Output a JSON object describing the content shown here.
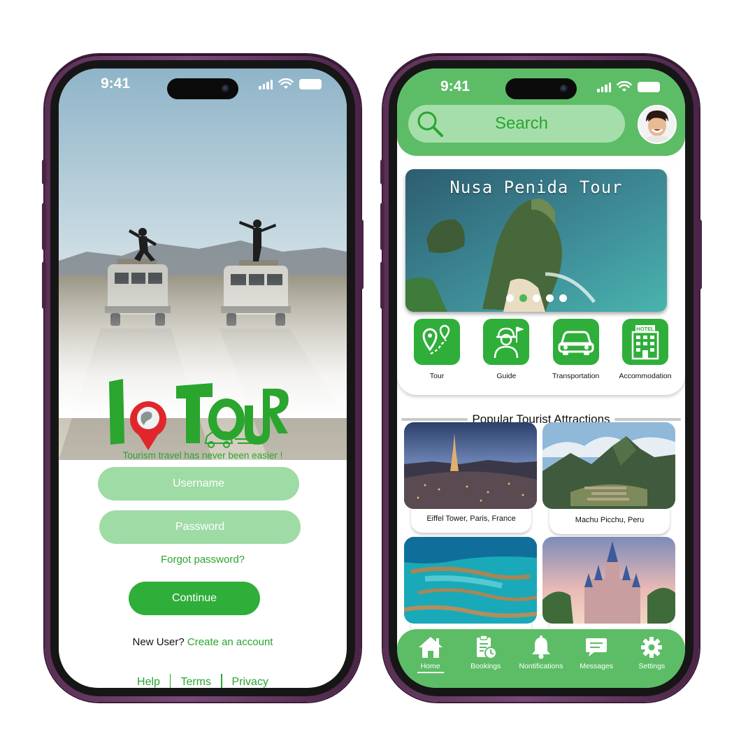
{
  "colors": {
    "brand_green": "#2fae3a",
    "light_green": "#9fdba5",
    "bar_green": "#5cbd66",
    "logo_red": "#e0262b",
    "frame_purple": "#5a2f55"
  },
  "login_screen": {
    "status_time": "9:41",
    "brand": {
      "logo_text": "I TOUR",
      "tagline": "Tourism travel has never been easier !"
    },
    "username_placeholder": "Username",
    "password_placeholder": "Password",
    "forgot_password": "Forgot password?",
    "continue_label": "Continue",
    "new_user_prefix": "New User?",
    "create_account": "Create an account",
    "footer": {
      "help": "Help",
      "terms": "Terms",
      "privacy": "Privacy"
    }
  },
  "home_screen": {
    "status_time": "9:41",
    "search_placeholder": "Search",
    "banner": {
      "title": "Nusa Penida Tour",
      "slide_count": 5,
      "active_slide": 2
    },
    "categories": [
      {
        "label": "Tour",
        "icon": "map-route-icon"
      },
      {
        "label": "Guide",
        "icon": "tour-guide-icon"
      },
      {
        "label": "Transportation",
        "icon": "car-icon"
      },
      {
        "label": "Accommodation",
        "icon": "hotel-icon",
        "icon_text": "HOTEL"
      }
    ],
    "section_title": "Popular Tourist Attractions",
    "attractions": [
      {
        "name": "Eiffel Tower, Paris, France"
      },
      {
        "name": "Machu Picchu, Peru"
      },
      {
        "name": ""
      },
      {
        "name": ""
      }
    ],
    "nav": [
      {
        "label": "Home",
        "icon": "home-icon",
        "active": true
      },
      {
        "label": "Bookings",
        "icon": "bookings-icon"
      },
      {
        "label": "Nontifications",
        "icon": "bell-icon"
      },
      {
        "label": "Messages",
        "icon": "messages-icon"
      },
      {
        "label": "Settings",
        "icon": "gear-icon"
      }
    ]
  }
}
